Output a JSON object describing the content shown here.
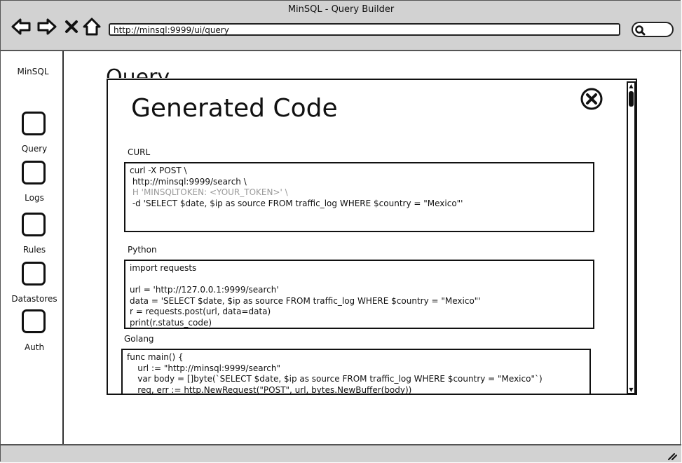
{
  "window": {
    "title": "MinSQL - Query Builder"
  },
  "browser": {
    "url": "http://minsql:9999/ui/query"
  },
  "sidebar": {
    "app_name": "MinSQL",
    "items": [
      {
        "label": "Query"
      },
      {
        "label": "Logs"
      },
      {
        "label": "Rules"
      },
      {
        "label": "Datastores"
      },
      {
        "label": "Auth"
      }
    ]
  },
  "page": {
    "heading": "Query"
  },
  "modal": {
    "title": "Generated Code",
    "sections": [
      {
        "label": "CURL",
        "lines": [
          "curl -X POST \\",
          " http://minsql:9999/search \\",
          " H 'MINSQLTOKEN: <YOUR_TOKEN>' \\",
          " -d 'SELECT $date, $ip as source FROM traffic_log WHERE $country = \"Mexico\"'"
        ]
      },
      {
        "label": "Python",
        "lines": [
          "import requests",
          "",
          "url = 'http://127.0.0.1:9999/search'",
          "data = 'SELECT $date, $ip as source FROM traffic_log WHERE $country = \"Mexico\"'",
          "r = requests.post(url, data=data)",
          "print(r.status_code)"
        ]
      },
      {
        "label": "Golang",
        "lines": [
          "func main() {",
          "    url := \"http://minsql:9999/search\"",
          "    var body = []byte(`SELECT $date, $ip as source FROM traffic_log WHERE $country = \"Mexico\"`)",
          "    req, err := http.NewRequest(\"POST\", url, bytes.NewBuffer(body))"
        ]
      }
    ]
  }
}
